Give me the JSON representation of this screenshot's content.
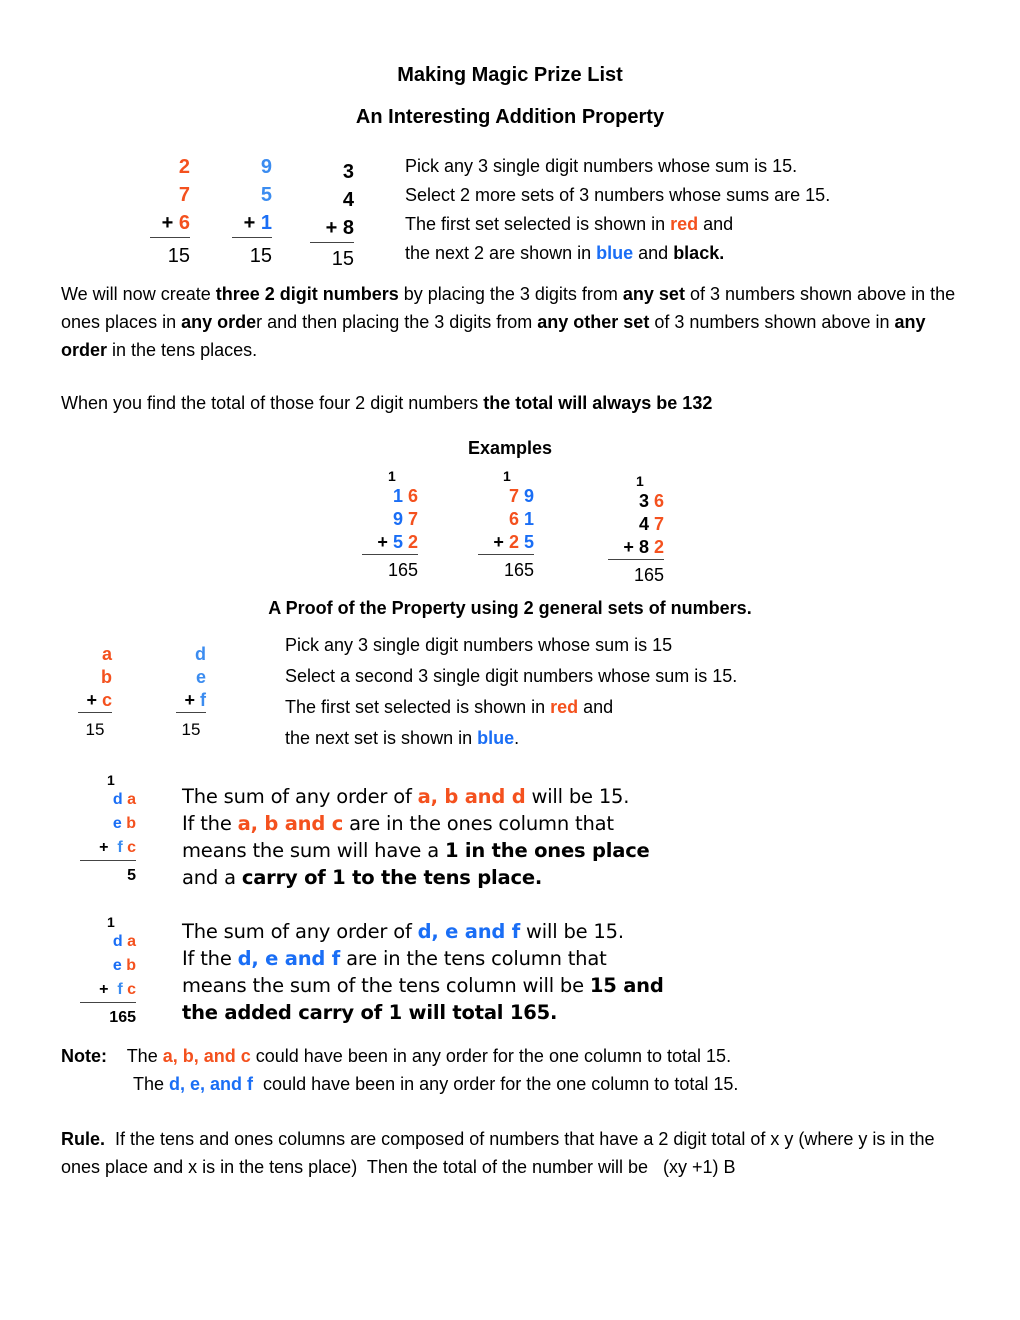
{
  "header": {
    "title": "Making Magic Prize List",
    "subtitle": "An Interesting Addition Property"
  },
  "sets": [
    {
      "color": "red",
      "digits": [
        "2",
        "7",
        "6"
      ],
      "sum": "15"
    },
    {
      "color": "blue",
      "digits": [
        "9",
        "5",
        "1"
      ],
      "sum": "15"
    },
    {
      "color": "black",
      "digits": [
        "3",
        "4",
        "8"
      ],
      "sum": "15"
    }
  ],
  "plus": "+",
  "intro": {
    "line1": "Pick any 3 single digit numbers whose sum is 15.",
    "line2": "Select 2 more sets of 3 numbers whose sums are 15.",
    "line3_a": "The first set selected is shown in ",
    "line3_red": "red",
    "line3_b": " and",
    "line4_a": "the next 2 are shown in ",
    "line4_blue": "blue",
    "line4_b": " and ",
    "line4_black": "black."
  },
  "explanation": {
    "p1_a": "We will now create ",
    "p1_b1": "three 2 digit numbers",
    "p1_c": " by placing the 3 digits from ",
    "p1_b2": "any set",
    "p1_d": " of 3 numbers shown above in the ones places in ",
    "p1_b3": "any orde",
    "p1_e": "r and then placing the 3 digits from ",
    "p1_b4": "any other set",
    "p1_f": " of 3 numbers shown above in ",
    "p1_b5": "any order",
    "p1_g": " in the tens places.",
    "p2_a": "When you find the total of those four 2 digit numbers ",
    "p2_b": "the total will always be 132"
  },
  "examples": {
    "heading": "Examples",
    "items": [
      {
        "carry": "1",
        "rows": [
          [
            "1",
            "6"
          ],
          [
            "9",
            "7"
          ],
          [
            "5",
            "2"
          ]
        ],
        "total": "165"
      },
      {
        "carry": "1",
        "rows": [
          [
            "7",
            "9"
          ],
          [
            "6",
            "1"
          ],
          [
            "2",
            "5"
          ]
        ],
        "total": "165"
      },
      {
        "carry": "1",
        "rows": [
          [
            "3",
            "6"
          ],
          [
            "4",
            "7"
          ],
          [
            "8",
            "2"
          ]
        ],
        "total": "165"
      }
    ]
  },
  "proof": {
    "heading": "A Proof of the Property using 2 general sets of numbers.",
    "red_set": [
      "a",
      "b",
      "c"
    ],
    "blue_set": [
      "d",
      "e",
      "f"
    ],
    "sum": "15",
    "line1": "Pick any 3 single digit numbers whose sum is 15",
    "line2": "Select a second 3 single digit numbers whose sum is 15.",
    "line3_a": "The first set selected is shown in ",
    "line3_red": "red",
    "line3_b": " and",
    "line4_a": "the next set is shown in ",
    "line4_blue": "blue",
    "line4_b": "."
  },
  "step1": {
    "carry": "1",
    "rows": [
      [
        "d",
        "a"
      ],
      [
        "e",
        "b"
      ],
      [
        "f",
        "c"
      ]
    ],
    "total": "5",
    "l1_a": "The sum of any order of ",
    "l1_hl": "a, b and d",
    "l1_b": " will be 15.",
    "l2_a": "If the ",
    "l2_hl": "a, b and c",
    "l2_b": " are in the ones column that",
    "l3_a": "means the sum will have a ",
    "l3_b": "1 in the ones place",
    "l4_a": "and a ",
    "l4_b": "carry of 1 to the tens place."
  },
  "step2": {
    "carry": "1",
    "rows": [
      [
        "d",
        "a"
      ],
      [
        "e",
        "b"
      ],
      [
        "f",
        "c"
      ]
    ],
    "total": "165",
    "l1_a": "The sum of any order of ",
    "l1_hl": "d, e and f",
    "l1_b": " will be 15.",
    "l2_a": "If the ",
    "l2_hl": "d, e and f",
    "l2_b": " are in the tens column that",
    "l3_a": "means the sum of the tens column will be ",
    "l3_b": "15 and",
    "l4_b": "the added carry of 1 will total 165."
  },
  "note": {
    "label": "Note:",
    "l1_a": "The ",
    "l1_hl": "a, b, and c",
    "l1_b": " could have been in any order for the one column to total 15.",
    "l2_a": "The ",
    "l2_hl": "d, e, and f",
    "l2_b": "  could have been in any order for the one column to total 15."
  },
  "rule": {
    "label": "Rule.",
    "text": "  If the tens and ones columns are composed of numbers that have a 2 digit total of x y (where y is in the ones place and x is in the tens place)  Then the total of the number will be   (xy +1) B"
  },
  "colors": {
    "red": "#f4511e",
    "blue": "#1a6ef5",
    "black": "#000000"
  }
}
